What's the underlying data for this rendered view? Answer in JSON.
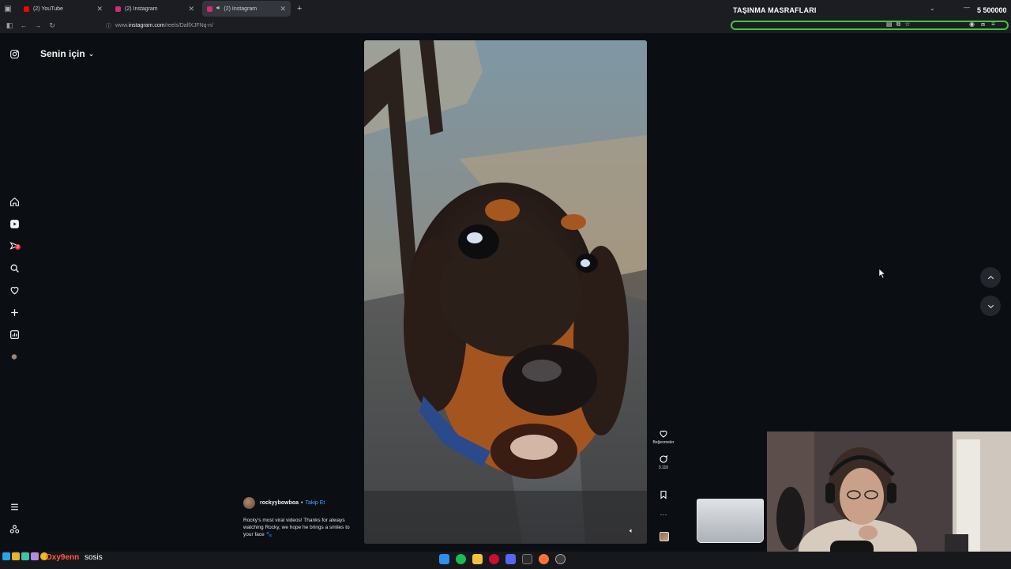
{
  "browser": {
    "tabs": [
      {
        "label": "(2) YouTube",
        "favicon_color": "#ff0000",
        "active": false
      },
      {
        "label": "(2) Instagram",
        "favicon_color": "#d62976",
        "active": false
      },
      {
        "label": "(2) Instagram",
        "favicon_color": "#d62976",
        "active": true
      }
    ],
    "url_prefix": "www.",
    "url_host": "instagram.com",
    "url_path": "/reels/DalfXJFNq-n/",
    "new_tab_icon": "plus-icon"
  },
  "overlay": {
    "title": "TAŞINMA MASRAFLARI",
    "count": "5 500000",
    "progress_color": "#3fc93a"
  },
  "instagram": {
    "feed_title": "Senin için",
    "notification_badge": "2",
    "sidebar_icons": [
      "instagram-logo-icon",
      "home-icon",
      "reels-icon",
      "messages-icon",
      "search-icon",
      "heart-icon",
      "create-icon",
      "dashboard-icon",
      "profile-icon",
      "menu-icon",
      "more-icon"
    ],
    "reel": {
      "author": "rockyybowboa",
      "separator": "•",
      "follow_label": "Takip Et",
      "caption": "Rocky's most viral videos! Thanks for always watching Rocky, we hope he brings a smiles to your face 🐾",
      "likes_label": "Beğenmeler",
      "comments_count": "3.110"
    }
  },
  "chat": {
    "username": "Oxy9enn",
    "message": "sosis"
  }
}
